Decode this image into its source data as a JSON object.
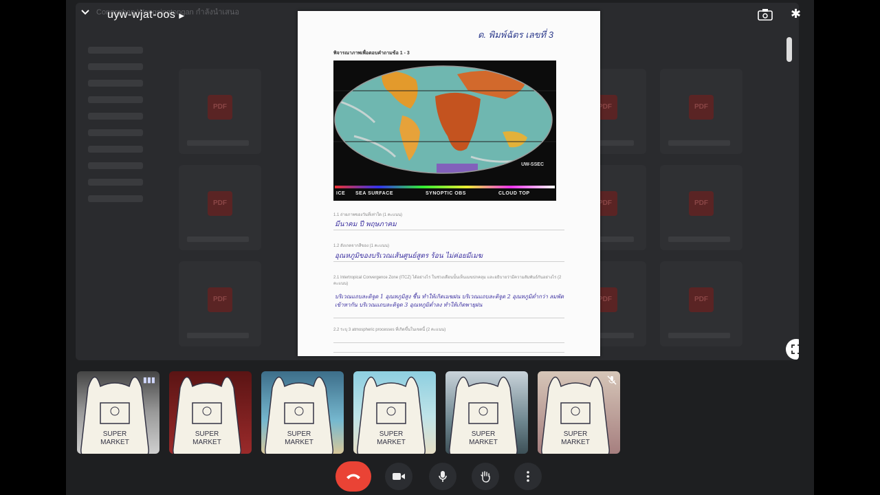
{
  "meeting": {
    "code": "uyw-wjat-oos",
    "presenter_caption": "Congsphan Wongsingtongan กำลังนำเสนอ"
  },
  "shared_screen": {
    "tiles": [
      {
        "badge": "PDF"
      },
      {
        "badge": "PDF"
      },
      {
        "badge": "PDF"
      },
      {
        "badge": "PDF"
      },
      {
        "badge": "PDF"
      },
      {
        "badge": "PDF"
      },
      {
        "badge": "PDF"
      },
      {
        "badge": "PDF"
      },
      {
        "badge": "PDF"
      },
      {
        "badge": "PDF"
      },
      {
        "badge": "PDF"
      },
      {
        "badge": "PDF"
      }
    ]
  },
  "document": {
    "handwritten_name": "ด. พิมพ์ฉัตร   เลขที่ 3",
    "heading": "พิจารณาภาพเพื่อตอบคำถามข้อ 1 - 3",
    "map_credit": "UW-SSEC",
    "legend": [
      "ICE",
      "SEA SURFACE",
      "SYNOPTIC OBS",
      "CLOUD TOP"
    ],
    "q1_1": "1.1 ถ่ายภาพของวันที่เท่าใด (1 คะแนน)",
    "a1_1": "มีนาคม ปี พฤษภาคม",
    "q1_2": "1.2 สังเกตจากสีของ (1 คะแนน)",
    "a1_2": "อุณหภูมิของบริเวณเส้นศูนย์สูตร ร้อน ไม่ค่อยมีเมฆ",
    "q2_1": "2.1 Intertropical Convergence Zone (ITCZ) ได้อย่างไร ในช่วงเดือนนั้นเห็นเมฆปกคลุม และอธิบายว่ามีความสัมพันธ์กันอย่างไร (2 คะแนน)",
    "a2_1": "บริเวณแถบละติจูด 1 อุณหภูมิสูง ชื้น ทำให้เกิดเมฆฝน บริเวณแถบละติจูด 2 อุณหภูมิต่ำกว่า ลมพัดเข้าหากัน บริเวณแถบละติจูด 3 อุณหภูมิต่ำลง ทำให้เกิดพายุฝน",
    "q2_2": "2.2 ระบุ 3 atmospheric processes ที่เกิดขึ้นในเขตนี้ (2 คะแนน)"
  },
  "participants": [
    {
      "label": "SUPER MARKET",
      "status": "speaking"
    },
    {
      "label": "SUPER MARKET",
      "status": ""
    },
    {
      "label": "SUPER MARKET",
      "status": ""
    },
    {
      "label": "SUPER MARKET",
      "status": ""
    },
    {
      "label": "SUPER MARKET",
      "status": ""
    },
    {
      "label": "SUPER MARKET",
      "status": "muted"
    }
  ],
  "controls": {
    "end_call": "phone-hangup-icon",
    "camera": "camera-icon",
    "microphone": "microphone-icon",
    "raise_hand": "hand-icon",
    "more": "more-vert-icon"
  },
  "colors": {
    "end_call": "#ea4335",
    "control_bg": "#2b2d31",
    "handwriting": "#3b2fa0"
  }
}
